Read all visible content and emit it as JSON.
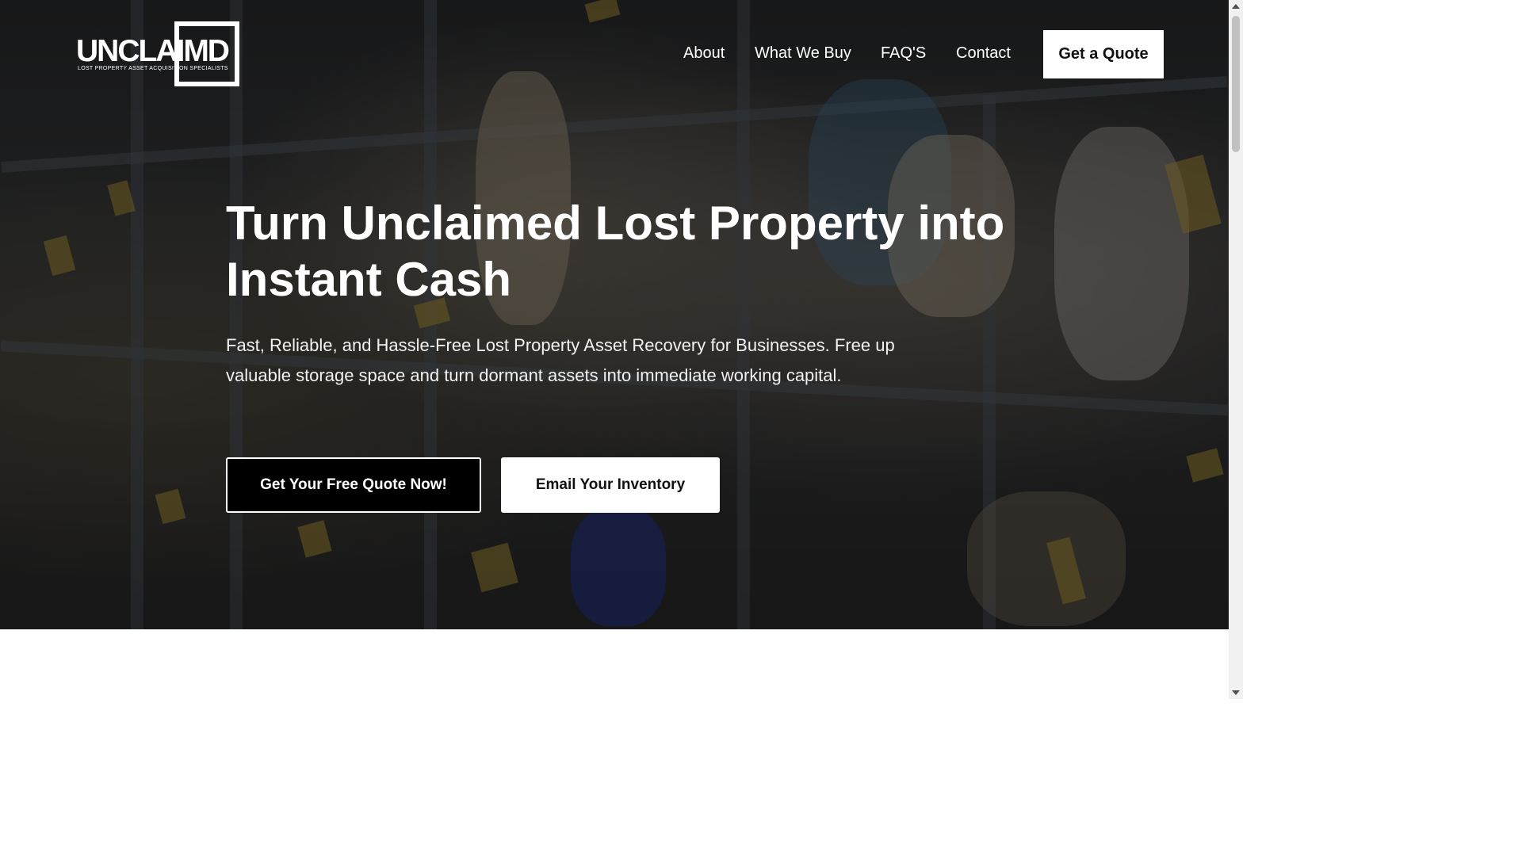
{
  "logo": {
    "word": "UNCLAIMD",
    "tagline": "LOST PROPERTY ASSET ACQUISITION SPECIALISTS"
  },
  "nav": {
    "items": [
      {
        "label": "About"
      },
      {
        "label": "What We Buy"
      },
      {
        "label": "FAQ'S"
      },
      {
        "label": "Contact"
      }
    ],
    "cta_label": "Get a Quote"
  },
  "hero": {
    "headline": "Turn Unclaimed Lost Property into Instant Cash",
    "subtext": "Fast, Reliable, and Hassle-Free Lost Property Asset Recovery for Businesses. Free up valuable storage space and turn dormant assets into immediate working capital.",
    "primary_button": "Get Your Free Quote Now!",
    "secondary_button": "Email Your Inventory"
  },
  "colors": {
    "hero_overlay": "#000000",
    "button_dark": "#000000",
    "button_light": "#ffffff",
    "text": "#ffffff"
  },
  "icons": [
    "scroll-up-arrow-icon",
    "scroll-down-arrow-icon"
  ]
}
